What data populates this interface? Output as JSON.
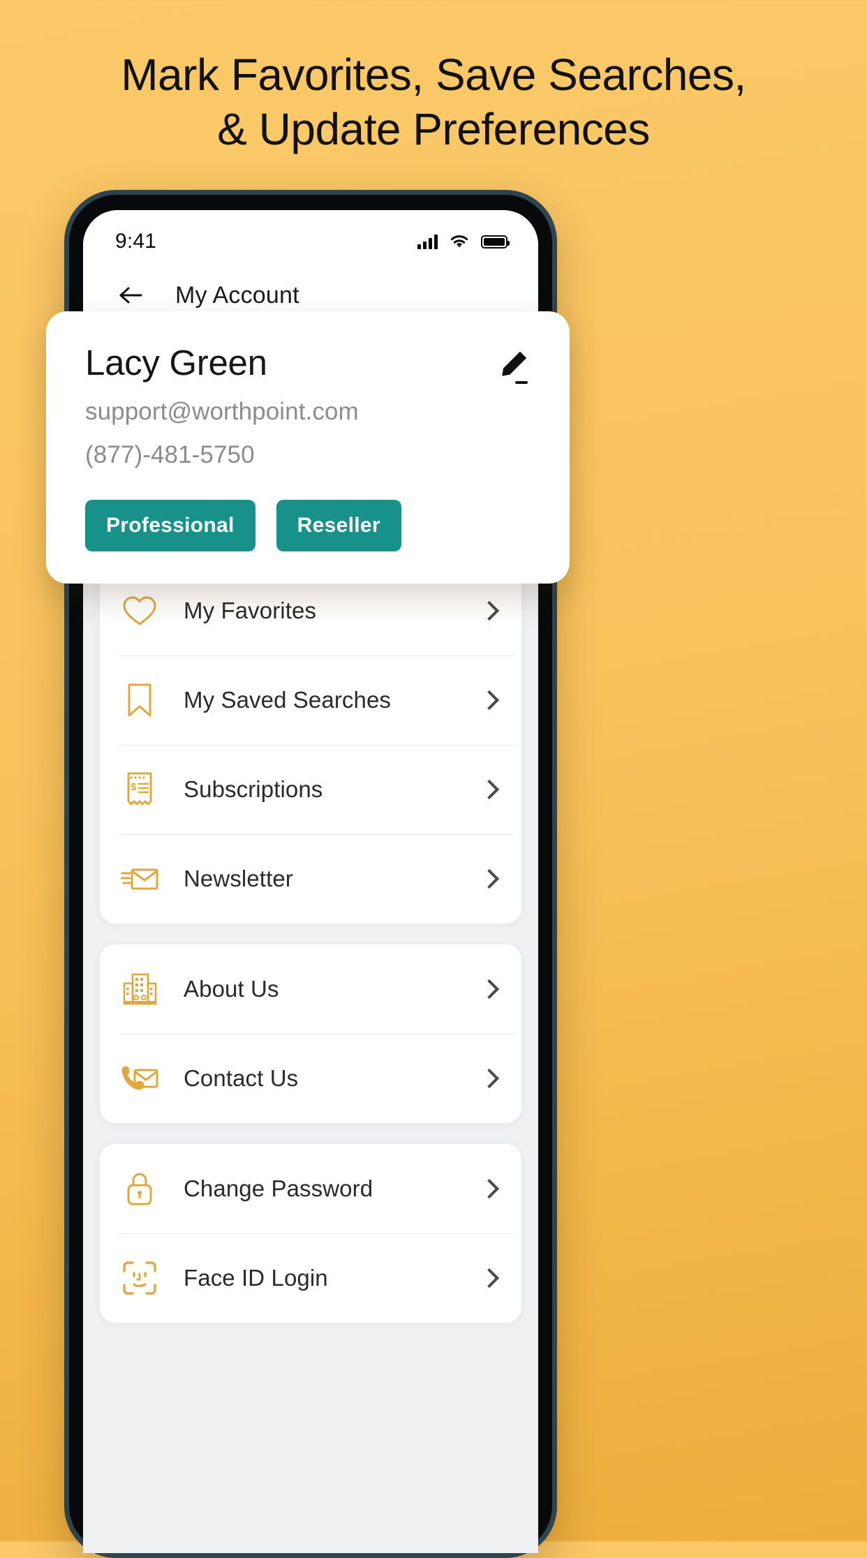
{
  "promo": {
    "headline_line1": "Mark Favorites, Save Searches,",
    "headline_line2": "& Update Preferences"
  },
  "status_bar": {
    "time": "9:41",
    "signal_icon": "cellular-signal-icon",
    "wifi_icon": "wifi-icon",
    "battery_icon": "battery-full-icon"
  },
  "appbar": {
    "back_icon": "back-arrow-icon",
    "title": "My Account"
  },
  "profile": {
    "name": "Lacy Green",
    "email": "support@worthpoint.com",
    "phone": "(877)-481-5750",
    "edit_icon": "pencil-edit-icon",
    "badges": [
      {
        "label": "Professional"
      },
      {
        "label": "Reseller"
      }
    ],
    "badge_color": "#179189"
  },
  "menu": {
    "icon_color": "#e0a83a",
    "groups": [
      {
        "name": "account-group",
        "items": [
          {
            "label": "My Favorites",
            "icon": "heart-icon"
          },
          {
            "label": "My Saved Searches",
            "icon": "bookmark-icon"
          },
          {
            "label": "Subscriptions",
            "icon": "receipt-dollar-icon"
          },
          {
            "label": "Newsletter",
            "icon": "envelope-send-icon"
          }
        ]
      },
      {
        "name": "info-group",
        "items": [
          {
            "label": "About Us",
            "icon": "building-icon"
          },
          {
            "label": "Contact Us",
            "icon": "phone-envelope-icon"
          }
        ]
      },
      {
        "name": "security-group",
        "items": [
          {
            "label": "Change Password",
            "icon": "lock-icon"
          },
          {
            "label": "Face ID Login",
            "icon": "face-id-icon"
          }
        ]
      }
    ]
  }
}
